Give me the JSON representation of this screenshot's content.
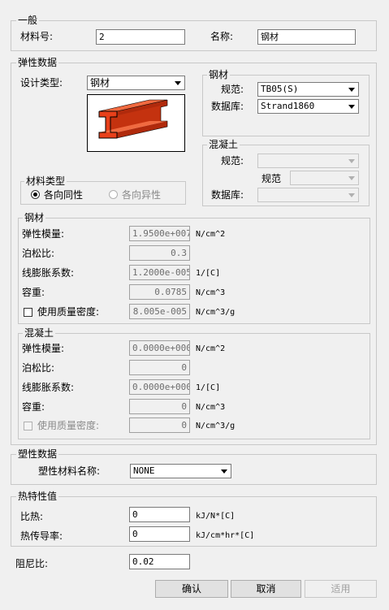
{
  "general": {
    "legend": "一般",
    "material_no_label": "材料号:",
    "material_no_value": "2",
    "name_label": "名称:",
    "name_value": "钢材"
  },
  "elastic": {
    "legend": "弹性数据",
    "design_type_label": "设计类型:",
    "design_type_value": "钢材",
    "steel_group": {
      "legend": "钢材",
      "spec_label": "规范:",
      "spec_value": "TB05(S)",
      "db_label": "数据库:",
      "db_value": "Strand1860"
    },
    "concrete_group": {
      "legend": "混凝土",
      "spec_label": "规范:",
      "spec2_label": "规范",
      "db_label": "数据库:"
    },
    "material_type": {
      "legend": "材料类型",
      "isotropic_label": "各向同性",
      "anisotropic_label": "各向异性"
    },
    "steel_props": {
      "legend": "钢材",
      "modulus_label": "弹性模量:",
      "modulus_value": "1.9500e+007",
      "modulus_unit": "N/cm^2",
      "poisson_label": "泊松比:",
      "poisson_value": "0.3",
      "thermal_label": "线膨胀系数:",
      "thermal_value": "1.2000e-005",
      "thermal_unit": "1/[C]",
      "weight_label": "容重:",
      "weight_value": "0.0785",
      "weight_unit": "N/cm^3",
      "mass_density_label": "使用质量密度:",
      "mass_density_value": "8.005e-005",
      "mass_density_unit": "N/cm^3/g"
    },
    "concrete_props": {
      "legend": "混凝土",
      "modulus_label": "弹性模量:",
      "modulus_value": "0.0000e+000",
      "modulus_unit": "N/cm^2",
      "poisson_label": "泊松比:",
      "poisson_value": "0",
      "thermal_label": "线膨胀系数:",
      "thermal_value": "0.0000e+000",
      "thermal_unit": "1/[C]",
      "weight_label": "容重:",
      "weight_value": "0",
      "weight_unit": "N/cm^3",
      "mass_density_label": "使用质量密度:",
      "mass_density_value": "0",
      "mass_density_unit": "N/cm^3/g"
    }
  },
  "plastic": {
    "legend": "塑性数据",
    "name_label": "塑性材料名称:",
    "name_value": "NONE"
  },
  "thermal": {
    "legend": "热特性值",
    "specific_heat_label": "比热:",
    "specific_heat_value": "0",
    "specific_heat_unit": "kJ/N*[C]",
    "conductivity_label": "热传导率:",
    "conductivity_value": "0",
    "conductivity_unit": "kJ/cm*hr*[C]"
  },
  "damping": {
    "label": "阻尼比:",
    "value": "0.02"
  },
  "buttons": {
    "ok": "确认",
    "cancel": "取消",
    "apply": "适用"
  },
  "colors": {
    "beam_red": "#e8401a",
    "beam_dark": "#b02a0c"
  }
}
